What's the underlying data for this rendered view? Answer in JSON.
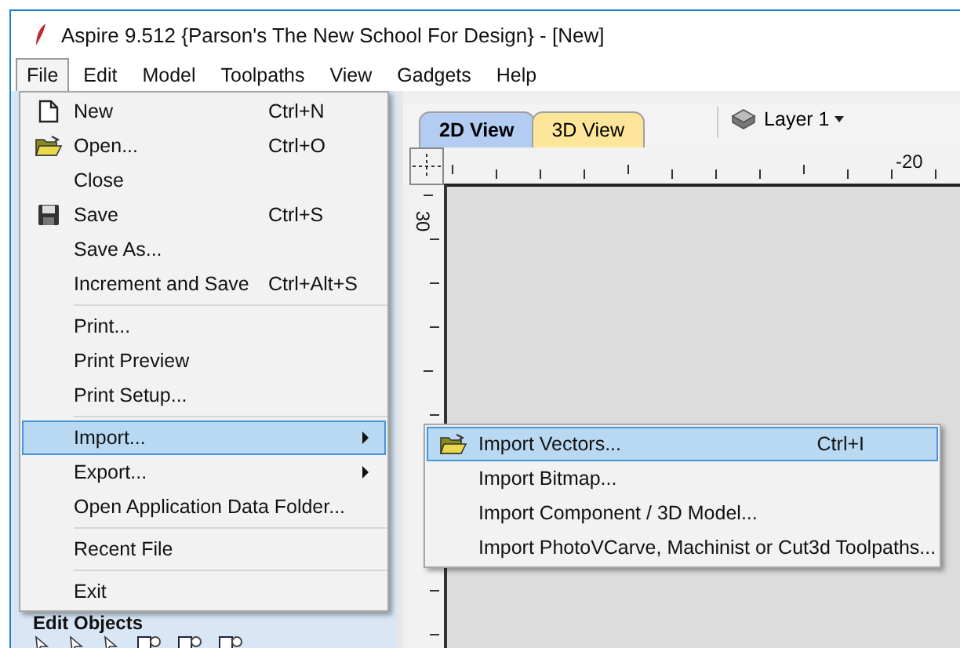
{
  "window": {
    "title": "Aspire 9.512 {Parson's The New School For Design} - [New]"
  },
  "menu_bar": [
    {
      "label": "File",
      "selected": true
    },
    {
      "label": "Edit",
      "selected": false
    },
    {
      "label": "Model",
      "selected": false
    },
    {
      "label": "Toolpaths",
      "selected": false
    },
    {
      "label": "View",
      "selected": false
    },
    {
      "label": "Gadgets",
      "selected": false
    },
    {
      "label": "Help",
      "selected": false
    }
  ],
  "file_menu": {
    "items": [
      {
        "kind": "item",
        "label": "New",
        "shortcut": "Ctrl+N",
        "selected": false
      },
      {
        "kind": "item",
        "label": "Open...",
        "shortcut": "Ctrl+O",
        "selected": false
      },
      {
        "kind": "item",
        "label": "Close",
        "selected": false
      },
      {
        "kind": "item",
        "label": "Save",
        "shortcut": "Ctrl+S",
        "selected": false
      },
      {
        "kind": "item",
        "label": "Save As...",
        "selected": false
      },
      {
        "kind": "item",
        "label": "Increment and Save",
        "shortcut": "Ctrl+Alt+S",
        "selected": false
      },
      {
        "kind": "separator"
      },
      {
        "kind": "item",
        "label": "Print...",
        "selected": false
      },
      {
        "kind": "item",
        "label": "Print Preview",
        "selected": false
      },
      {
        "kind": "item",
        "label": "Print Setup...",
        "selected": false
      },
      {
        "kind": "separator"
      },
      {
        "kind": "submenu",
        "label": "Import...",
        "selected": true
      },
      {
        "kind": "submenu",
        "label": "Export...",
        "selected": false
      },
      {
        "kind": "item",
        "label": "Open Application Data Folder...",
        "selected": false
      },
      {
        "kind": "separator"
      },
      {
        "kind": "item",
        "label": "Recent File",
        "selected": false
      },
      {
        "kind": "separator"
      },
      {
        "kind": "item",
        "label": "Exit",
        "selected": false
      }
    ]
  },
  "import_submenu": {
    "items": [
      {
        "kind": "item",
        "label": "Import Vectors...",
        "shortcut": "Ctrl+I",
        "selected": true
      },
      {
        "kind": "item",
        "label": "Import Bitmap...",
        "selected": false
      },
      {
        "kind": "item",
        "label": "Import Component / 3D Model...",
        "selected": false
      },
      {
        "kind": "item",
        "label": "Import PhotoVCarve, Machinist or Cut3d Toolpaths...",
        "selected": false
      }
    ]
  },
  "view_tabs": [
    {
      "label": "2D View",
      "selected": true,
      "color": "#b3cdf2"
    },
    {
      "label": "3D View",
      "selected": false,
      "color": "#fde59a"
    }
  ],
  "layer_selector": {
    "label": "Layer 1"
  },
  "ruler": {
    "horizontal_label": "-20",
    "vertical_label": "30"
  },
  "left_panel": {
    "heading": "Edit Objects"
  }
}
